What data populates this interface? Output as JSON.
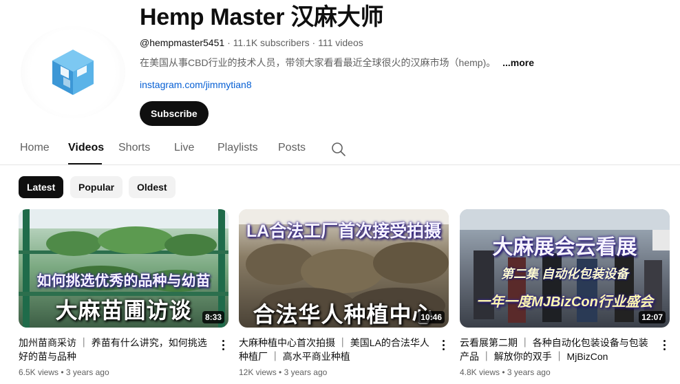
{
  "channel": {
    "title": "Hemp Master 汉麻大师",
    "handle": "@hempmaster5451",
    "subscribers": "11.1K subscribers",
    "videos_count": "111 videos",
    "description": "在美国从事CBD行业的技术人员，带领大家看看最近全球很火的汉麻市场（hemp)。",
    "more_label": "...more",
    "link": "instagram.com/jimmytian8",
    "subscribe_label": "Subscribe",
    "avatar_icon": "cube-logo-icon",
    "accent": "#4aa8e0"
  },
  "tabs": [
    {
      "label": "Home",
      "active": false
    },
    {
      "label": "Videos",
      "active": true
    },
    {
      "label": "Shorts",
      "active": false
    },
    {
      "label": "Live",
      "active": false
    },
    {
      "label": "Playlists",
      "active": false
    },
    {
      "label": "Posts",
      "active": false
    }
  ],
  "search_icon": "search-icon",
  "filters": [
    {
      "label": "Latest",
      "active": true
    },
    {
      "label": "Popular",
      "active": false
    },
    {
      "label": "Oldest",
      "active": false
    }
  ],
  "videos": [
    {
      "thumb_top": "如何挑选优秀的品种与幼苗",
      "thumb_big": "大麻苗圃访谈",
      "duration": "8:33",
      "title": "加州苗商采访 ｜ 养苗有什么讲究，如何挑选好的苗与品种",
      "views": "6.5K views",
      "age": "3 years ago"
    },
    {
      "thumb_top": "LA合法工厂首次接受拍摄",
      "thumb_big": "合法华人种植中心",
      "duration": "10:46",
      "title": "大麻种植中心首次拍摄 ｜ 美国LA的合法华人种植厂 ｜ 高水平商业种植",
      "views": "12K views",
      "age": "3 years ago"
    },
    {
      "thumb_top": "大麻展会云看展",
      "thumb_mid": "第二集 自动化包装设备",
      "thumb_big": "一年一度MJBizCon行业盛会",
      "duration": "12:07",
      "title": "云看展第二期 ｜ 各种自动化包装设备与包装产品 ｜ 解放你的双手 ｜ MjBizCon",
      "views": "4.8K views",
      "age": "3 years ago"
    }
  ]
}
